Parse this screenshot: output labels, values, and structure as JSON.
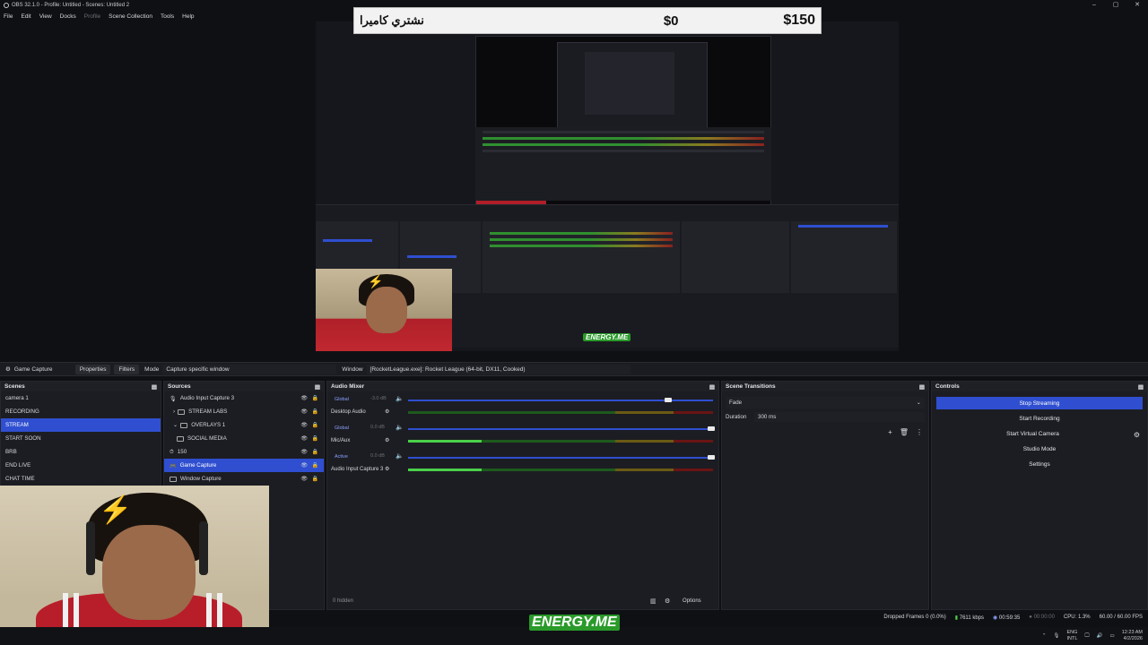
{
  "window": {
    "title": "OBS 32.1.0 - Profile: Untitled - Scenes: Untitled 2",
    "controls": [
      "–",
      "▢",
      "✕"
    ]
  },
  "menu": [
    "File",
    "Edit",
    "View",
    "Docks",
    "Profile",
    "Scene Collection",
    "Tools",
    "Help"
  ],
  "overlay": {
    "camera_label": "نشتري كاميرا",
    "price_current": "$0",
    "price_goal": "$150"
  },
  "brand_text": "ENERGY.ME",
  "source_toolbar": {
    "source_name": "Game Capture",
    "properties_label": "Properties",
    "filters_label": "Filters",
    "mode_label": "Mode",
    "mode_value": "Capture specific window",
    "window_label": "Window",
    "window_value": "[RocketLeague.exe]: Rocket League (64-bit, DX11, Cooked)"
  },
  "scenes": {
    "title": "Scenes",
    "items": [
      "camera 1",
      "RECORDING",
      "STREAM",
      "START SOON",
      "BRB",
      "END LIVE",
      "CHAT TIME"
    ],
    "selected": "STREAM"
  },
  "sources": {
    "title": "Sources",
    "items": [
      {
        "label": "Audio Input Capture 3"
      },
      {
        "label": "STREAM LABS"
      },
      {
        "label": "OVERLAYS 1"
      },
      {
        "label": "SOCIAL MEDIA"
      },
      {
        "label": "150"
      },
      {
        "label": "Game Capture"
      },
      {
        "label": "Window Capture"
      }
    ],
    "selected": "Game Capture"
  },
  "mixer": {
    "title": "Audio Mixer",
    "channels": [
      {
        "badge": "Global",
        "name": "Desktop Audio",
        "db": "-3.0 dB",
        "level": 0.0
      },
      {
        "badge": "Global",
        "name": "Mic/Aux",
        "db": "0.0 dB",
        "level": 0.24
      },
      {
        "badge": "Active",
        "name": "Audio Input Capture 3",
        "db": "0.0 dB",
        "level": 0.24
      }
    ],
    "hidden_label": "0 hidden",
    "options_label": "Options"
  },
  "transitions": {
    "title": "Scene Transitions",
    "type": "Fade",
    "duration_label": "Duration",
    "duration_value": "300 ms"
  },
  "controls": {
    "title": "Controls",
    "buttons": [
      "Stop Streaming",
      "Start Recording",
      "Start Virtual Camera",
      "Studio Mode",
      "Settings"
    ]
  },
  "status": {
    "dropped": "Dropped Frames 0 (0.0%)",
    "bitrate": "7611 kbps",
    "stream_time": "00:59:35",
    "rec_time": "00:00:00",
    "cpu": "CPU: 1.3%",
    "fps": "60.00 / 60.00 FPS"
  },
  "tray": {
    "lang_top": "ENG",
    "lang_bottom": "INTL",
    "time": "12:23 AM",
    "date": "4/2/2026"
  },
  "colors": {
    "accent": "#2f4fd0",
    "bg": "#0f1014",
    "panel": "#1c1d22"
  }
}
